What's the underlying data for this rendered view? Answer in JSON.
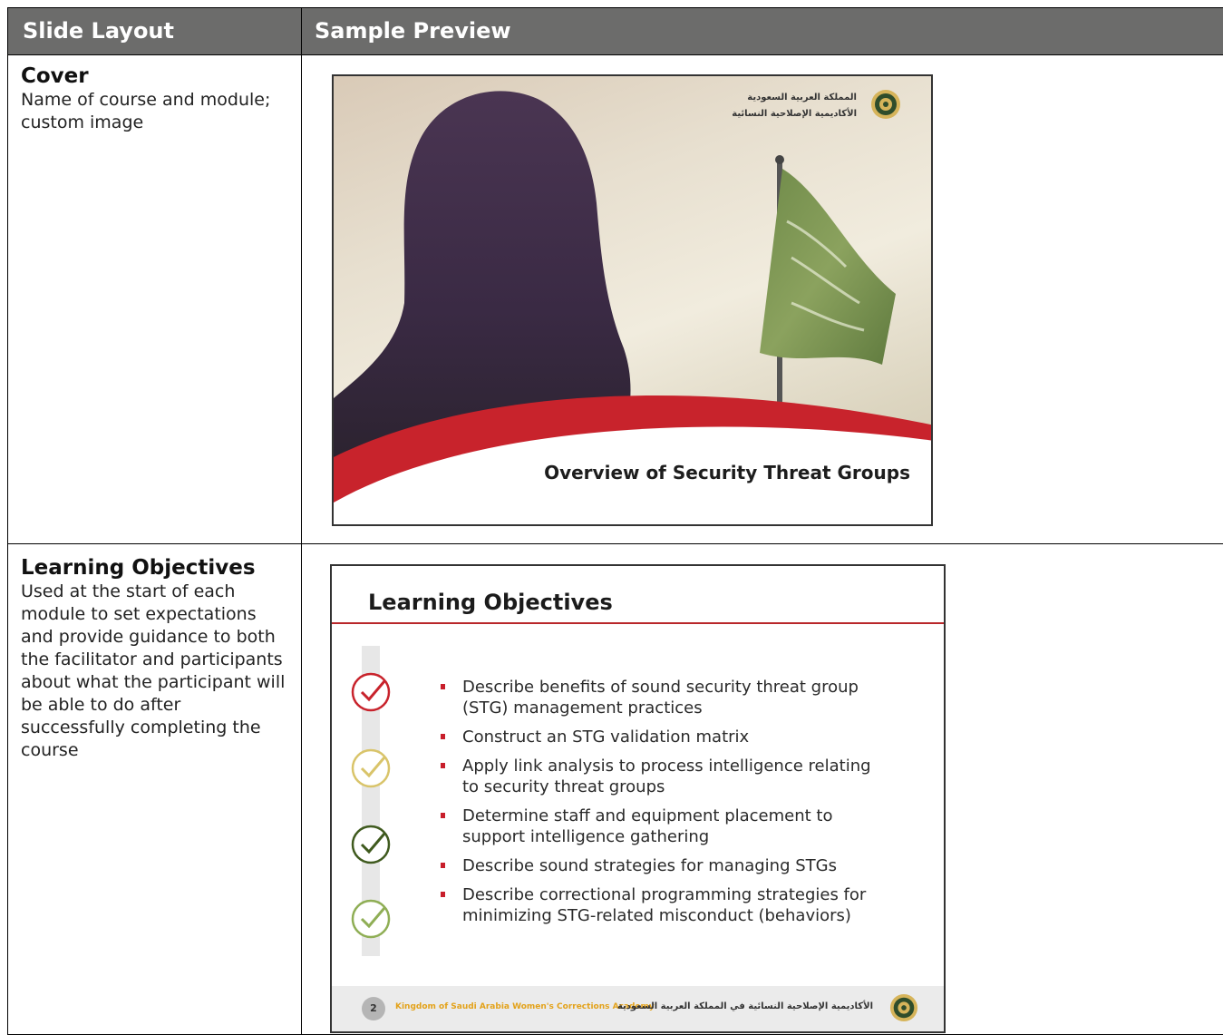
{
  "header": {
    "col1": "Slide Layout",
    "col2": "Sample Preview"
  },
  "rows": [
    {
      "title": "Cover",
      "description": "Name of course and module; custom image",
      "preview": {
        "arabic_line1": "المملكة العربية السعودية",
        "arabic_line2": "الأكاديمية الإصلاحية النسائية",
        "slide_title": "Overview of Security Threat Groups",
        "icon": "academy-emblem-icon"
      }
    },
    {
      "title": "Learning Objectives",
      "description": "Used at the start of each module to set expectations and provide guidance to both the facilitator and participants about what the participant will be able to do after successfully completing the course",
      "preview": {
        "slide_title": "Learning Objectives",
        "objectives": [
          "Describe benefits of sound security threat group (STG) management practices",
          "Construct an STG validation matrix",
          "Apply link analysis to process intelligence relating to security threat groups",
          "Determine staff and equipment placement to support intelligence gathering",
          "Describe sound strategies for managing STGs",
          "Describe correctional programming strategies for minimizing STG-related misconduct (behaviors)"
        ],
        "check_colors": [
          "#c8232c",
          "#d9c46a",
          "#3f5a1e",
          "#8fae55"
        ],
        "page_number": "2",
        "footer_english": "Kingdom of Saudi Arabia Women's Corrections Academy",
        "footer_arabic": "الأكاديمية الإصلاحية النسائية في المملكة العربية السعودية"
      }
    }
  ],
  "colors": {
    "header_bg": "#6c6c6b",
    "accent_red": "#c8232c",
    "footer_gold": "#e3a21a"
  }
}
